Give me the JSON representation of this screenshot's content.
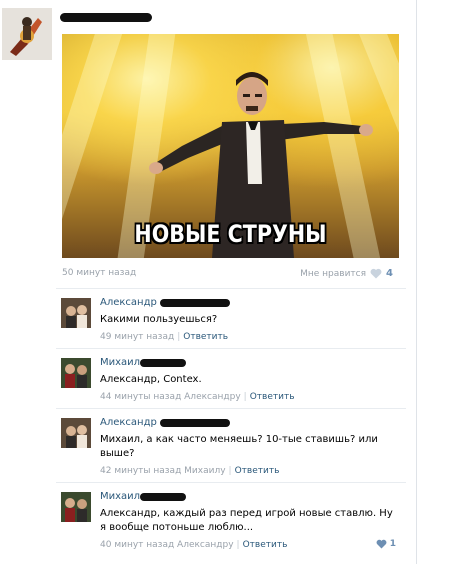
{
  "post": {
    "image_caption": "НОВЫЕ СТРУНЫ",
    "time": "50 минут назад",
    "like_label": "Мне нравится",
    "like_count": "4"
  },
  "comments": [
    {
      "author": "Александр",
      "text": "Какими пользуешься?",
      "time": "49 минут назад",
      "reply_to": "",
      "reply_label": "Ответить",
      "likes": ""
    },
    {
      "author": "Михаил",
      "text": "Александр, Contex.",
      "time": "44 минуты назад Александру",
      "reply_to": "",
      "reply_label": "Ответить",
      "likes": ""
    },
    {
      "author": "Александр",
      "text": "Михаил, а как часто меняешь? 10-тые ставишь? или выше?",
      "time": "42 минуты назад Михаилу",
      "reply_to": "",
      "reply_label": "Ответить",
      "likes": ""
    },
    {
      "author": "Михаил",
      "text": "Александр, каждый раз перед игрой новые ставлю. Ну я вообще потоньше люблю...",
      "time": "40 минут назад Александру",
      "reply_to": "",
      "reply_label": "Ответить",
      "likes": "1"
    }
  ],
  "colors": {
    "link": "#2b587a",
    "meta": "#9aa2ab",
    "like": "#6d8fb3"
  }
}
